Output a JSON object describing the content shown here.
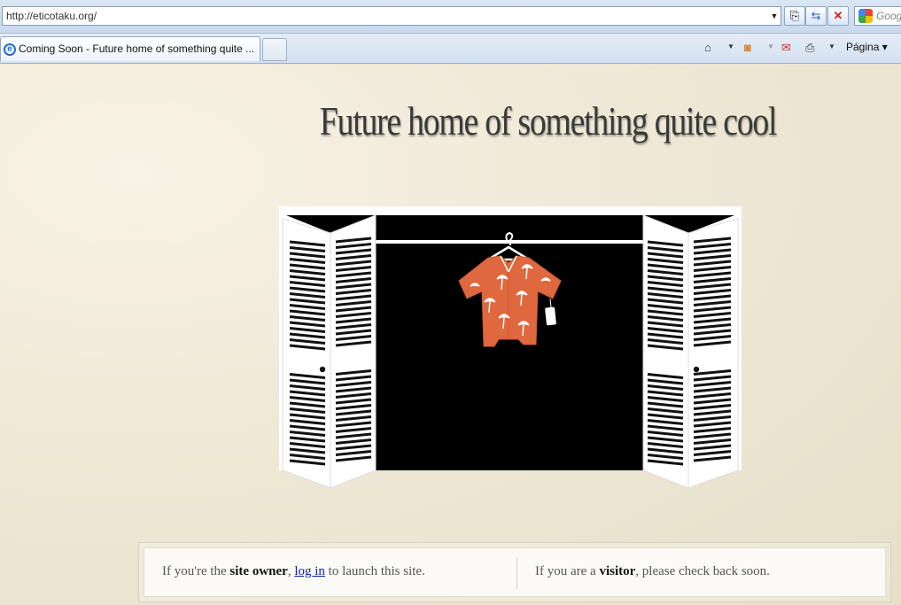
{
  "browser": {
    "url": "http://eticotaku.org/",
    "search_placeholder": "Goog",
    "tab_title": "Coming Soon - Future home of something quite ...",
    "page_menu": "Página ▾"
  },
  "page": {
    "headline": "Future home of something quite cool"
  },
  "footer": {
    "owner_prefix": "If you're the ",
    "owner_bold": "site owner",
    "owner_comma": ", ",
    "owner_link": "log in",
    "owner_suffix": " to launch this site.",
    "visitor_prefix": "If you are a ",
    "visitor_bold": "visitor",
    "visitor_suffix": ", please check back soon."
  },
  "colors": {
    "shirt": "#e0683e",
    "link": "#0a1fa8"
  }
}
